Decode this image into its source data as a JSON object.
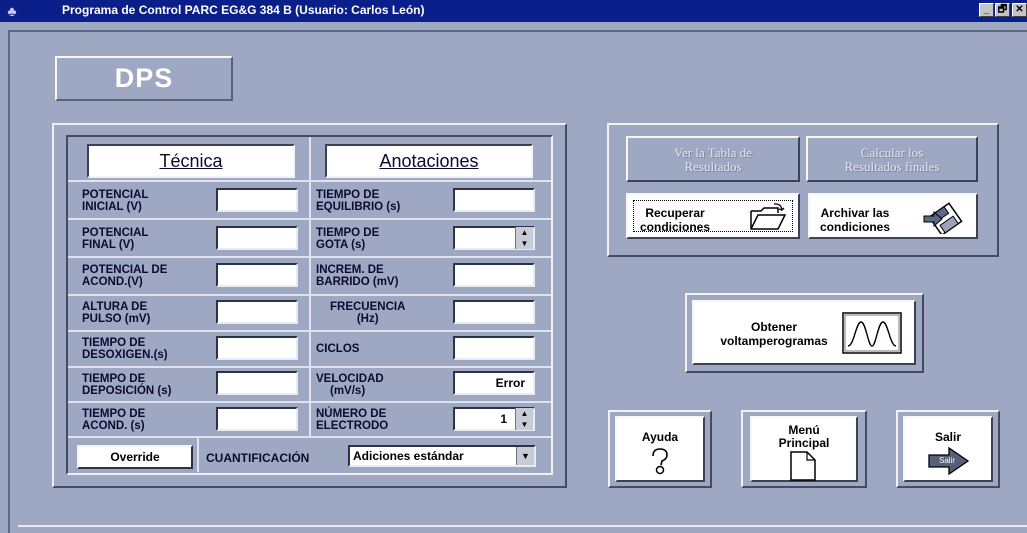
{
  "window": {
    "title": "Programa de Control PARC EG&G 384 B    (Usuario: Carlos León)",
    "controls": [
      "_",
      "🗗",
      "✕"
    ]
  },
  "header": {
    "badge": "DPS"
  },
  "left_panel": {
    "col_headers": {
      "tecnica": "Técnica",
      "anotaciones": "Anotaciones"
    },
    "left_fields": [
      {
        "label1": "POTENCIAL",
        "label2": "INICIAL (V)",
        "value": ""
      },
      {
        "label1": "POTENCIAL",
        "label2": "FINAL (V)",
        "value": ""
      },
      {
        "label1": "POTENCIAL DE",
        "label2": "ACOND.(V)",
        "value": ""
      },
      {
        "label1": "ALTURA DE",
        "label2": "PULSO (mV)",
        "value": ""
      },
      {
        "label1": "TIEMPO DE",
        "label2": "DESOXIGEN.(s)",
        "value": ""
      },
      {
        "label1": "TIEMPO DE",
        "label2": "DEPOSICIÓN (s)",
        "value": ""
      },
      {
        "label1": "TIEMPO DE",
        "label2": "ACOND. (s)",
        "value": ""
      }
    ],
    "right_fields": [
      {
        "label1": "TIEMPO DE",
        "label2": "EQUILIBRIO (s)",
        "value": ""
      },
      {
        "label1": "TIEMPO DE",
        "label2": "GOTA (s)",
        "value": ""
      },
      {
        "label1": "INCREM. DE",
        "label2": "BARRIDO (mV)",
        "value": ""
      },
      {
        "label1": "FRECUENCIA",
        "label2": "(Hz)",
        "value": ""
      },
      {
        "label1": "CICLOS",
        "label2": "",
        "value": ""
      },
      {
        "label1": "VELOCIDAD",
        "label2": "(mV/s)",
        "value": "Error"
      },
      {
        "label1": "NÚMERO DE",
        "label2": "ELECTRODO",
        "value": "1"
      }
    ],
    "override_label": "Override",
    "cuantificacion_label": "CUANTIFICACIÓN",
    "cuantificacion_value": "Adiciones estándar"
  },
  "right_panel": {
    "ver_tabla": {
      "line1": "Ver la Tabla de",
      "line2": "Resultados"
    },
    "calcular": {
      "line1": "Calcular los",
      "line2": "Resultados finales"
    },
    "recuperar": {
      "line1": "Recuperar",
      "line2": "condiciones"
    },
    "archivar": {
      "line1": "Archivar las",
      "line2": "condiciones"
    }
  },
  "obtener": {
    "line1": "Obtener",
    "line2": "voltamperogramas"
  },
  "bottom_buttons": {
    "ayuda": "Ayuda",
    "menu_line1": "Menú",
    "menu_line2": "Principal",
    "salir": "Salir",
    "salir_icon_text": "Salir"
  },
  "colors": {
    "titlebar": "#0a1f8a",
    "background": "#9ea8c3"
  }
}
